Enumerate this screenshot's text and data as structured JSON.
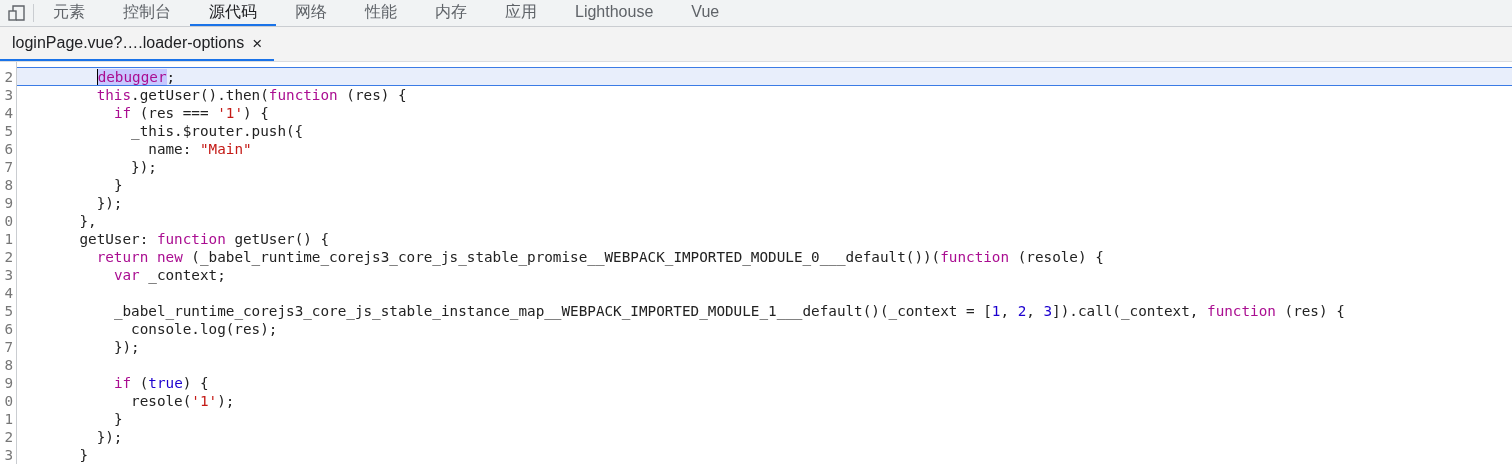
{
  "panel_tabs": [
    {
      "label": "元素",
      "selected": false
    },
    {
      "label": "控制台",
      "selected": false
    },
    {
      "label": "源代码",
      "selected": true
    },
    {
      "label": "网络",
      "selected": false
    },
    {
      "label": "性能",
      "selected": false
    },
    {
      "label": "内存",
      "selected": false
    },
    {
      "label": "应用",
      "selected": false
    },
    {
      "label": "Lighthouse",
      "selected": false
    },
    {
      "label": "Vue",
      "selected": false
    }
  ],
  "file_tabs": [
    {
      "label": "loginPage.vue?….loader-options",
      "close": "×",
      "selected": true
    }
  ],
  "code_lines": [
    {
      "number": "2",
      "highlighted": true,
      "tokens": [
        {
          "kind": "keyword",
          "text": "      debugger",
          "selected": true
        },
        {
          "kind": "plain",
          "text": ";"
        }
      ]
    },
    {
      "number": "3",
      "highlighted": false,
      "tokens": [
        {
          "kind": "keyword",
          "text": "      this"
        },
        {
          "kind": "plain",
          "text": ".getUser().then("
        },
        {
          "kind": "keyword",
          "text": "function"
        },
        {
          "kind": "plain",
          "text": " (res) {"
        }
      ]
    },
    {
      "number": "4",
      "highlighted": false,
      "tokens": [
        {
          "kind": "keyword",
          "text": "        if"
        },
        {
          "kind": "plain",
          "text": " (res === "
        },
        {
          "kind": "string",
          "text": "'1'"
        },
        {
          "kind": "plain",
          "text": ") {"
        }
      ]
    },
    {
      "number": "5",
      "highlighted": false,
      "tokens": [
        {
          "kind": "plain",
          "text": "          _this.$router.push({"
        }
      ]
    },
    {
      "number": "6",
      "highlighted": false,
      "tokens": [
        {
          "kind": "plain",
          "text": "            name: "
        },
        {
          "kind": "string",
          "text": "\"Main\""
        }
      ]
    },
    {
      "number": "7",
      "highlighted": false,
      "tokens": [
        {
          "kind": "plain",
          "text": "          });"
        }
      ]
    },
    {
      "number": "8",
      "highlighted": false,
      "tokens": [
        {
          "kind": "plain",
          "text": "        }"
        }
      ]
    },
    {
      "number": "9",
      "highlighted": false,
      "tokens": [
        {
          "kind": "plain",
          "text": "      });"
        }
      ]
    },
    {
      "number": "0",
      "highlighted": false,
      "tokens": [
        {
          "kind": "plain",
          "text": "    },"
        }
      ]
    },
    {
      "number": "1",
      "highlighted": false,
      "tokens": [
        {
          "kind": "plain",
          "text": "    getUser: "
        },
        {
          "kind": "keyword",
          "text": "function"
        },
        {
          "kind": "plain",
          "text": " getUser() {"
        }
      ]
    },
    {
      "number": "2",
      "highlighted": false,
      "tokens": [
        {
          "kind": "keyword",
          "text": "      return"
        },
        {
          "kind": "keyword",
          "text": " new"
        },
        {
          "kind": "plain",
          "text": " (_babel_runtime_corejs3_core_js_stable_promise__WEBPACK_IMPORTED_MODULE_0___default())("
        },
        {
          "kind": "keyword",
          "text": "function"
        },
        {
          "kind": "plain",
          "text": " (resole) {"
        }
      ]
    },
    {
      "number": "3",
      "highlighted": false,
      "tokens": [
        {
          "kind": "keyword",
          "text": "        var"
        },
        {
          "kind": "plain",
          "text": " _context;"
        }
      ]
    },
    {
      "number": "4",
      "highlighted": false
    },
    {
      "number": "5",
      "highlighted": false,
      "tokens": [
        {
          "kind": "plain",
          "text": "        _babel_runtime_corejs3_core_js_stable_instance_map__WEBPACK_IMPORTED_MODULE_1___default()(_context = ["
        },
        {
          "kind": "number",
          "text": "1"
        },
        {
          "kind": "plain",
          "text": ", "
        },
        {
          "kind": "number",
          "text": "2"
        },
        {
          "kind": "plain",
          "text": ", "
        },
        {
          "kind": "number",
          "text": "3"
        },
        {
          "kind": "plain",
          "text": "]).call(_context, "
        },
        {
          "kind": "keyword",
          "text": "function"
        },
        {
          "kind": "plain",
          "text": " (res) {"
        }
      ]
    },
    {
      "number": "6",
      "highlighted": false,
      "tokens": [
        {
          "kind": "plain",
          "text": "          console.log(res);"
        }
      ]
    },
    {
      "number": "7",
      "highlighted": false,
      "tokens": [
        {
          "kind": "plain",
          "text": "        });"
        }
      ]
    },
    {
      "number": "8",
      "highlighted": false
    },
    {
      "number": "9",
      "highlighted": false,
      "tokens": [
        {
          "kind": "keyword",
          "text": "        if"
        },
        {
          "kind": "plain",
          "text": " ("
        },
        {
          "kind": "number",
          "text": "true"
        },
        {
          "kind": "plain",
          "text": ") {"
        }
      ]
    },
    {
      "number": "0",
      "highlighted": false,
      "tokens": [
        {
          "kind": "plain",
          "text": "          resole("
        },
        {
          "kind": "string",
          "text": "'1'"
        },
        {
          "kind": "plain",
          "text": ");"
        }
      ]
    },
    {
      "number": "1",
      "highlighted": false,
      "tokens": [
        {
          "kind": "plain",
          "text": "        }"
        }
      ]
    },
    {
      "number": "2",
      "highlighted": false,
      "tokens": [
        {
          "kind": "plain",
          "text": "      });"
        }
      ]
    },
    {
      "number": "3",
      "highlighted": false,
      "tokens": [
        {
          "kind": "plain",
          "text": "    }"
        }
      ]
    }
  ]
}
